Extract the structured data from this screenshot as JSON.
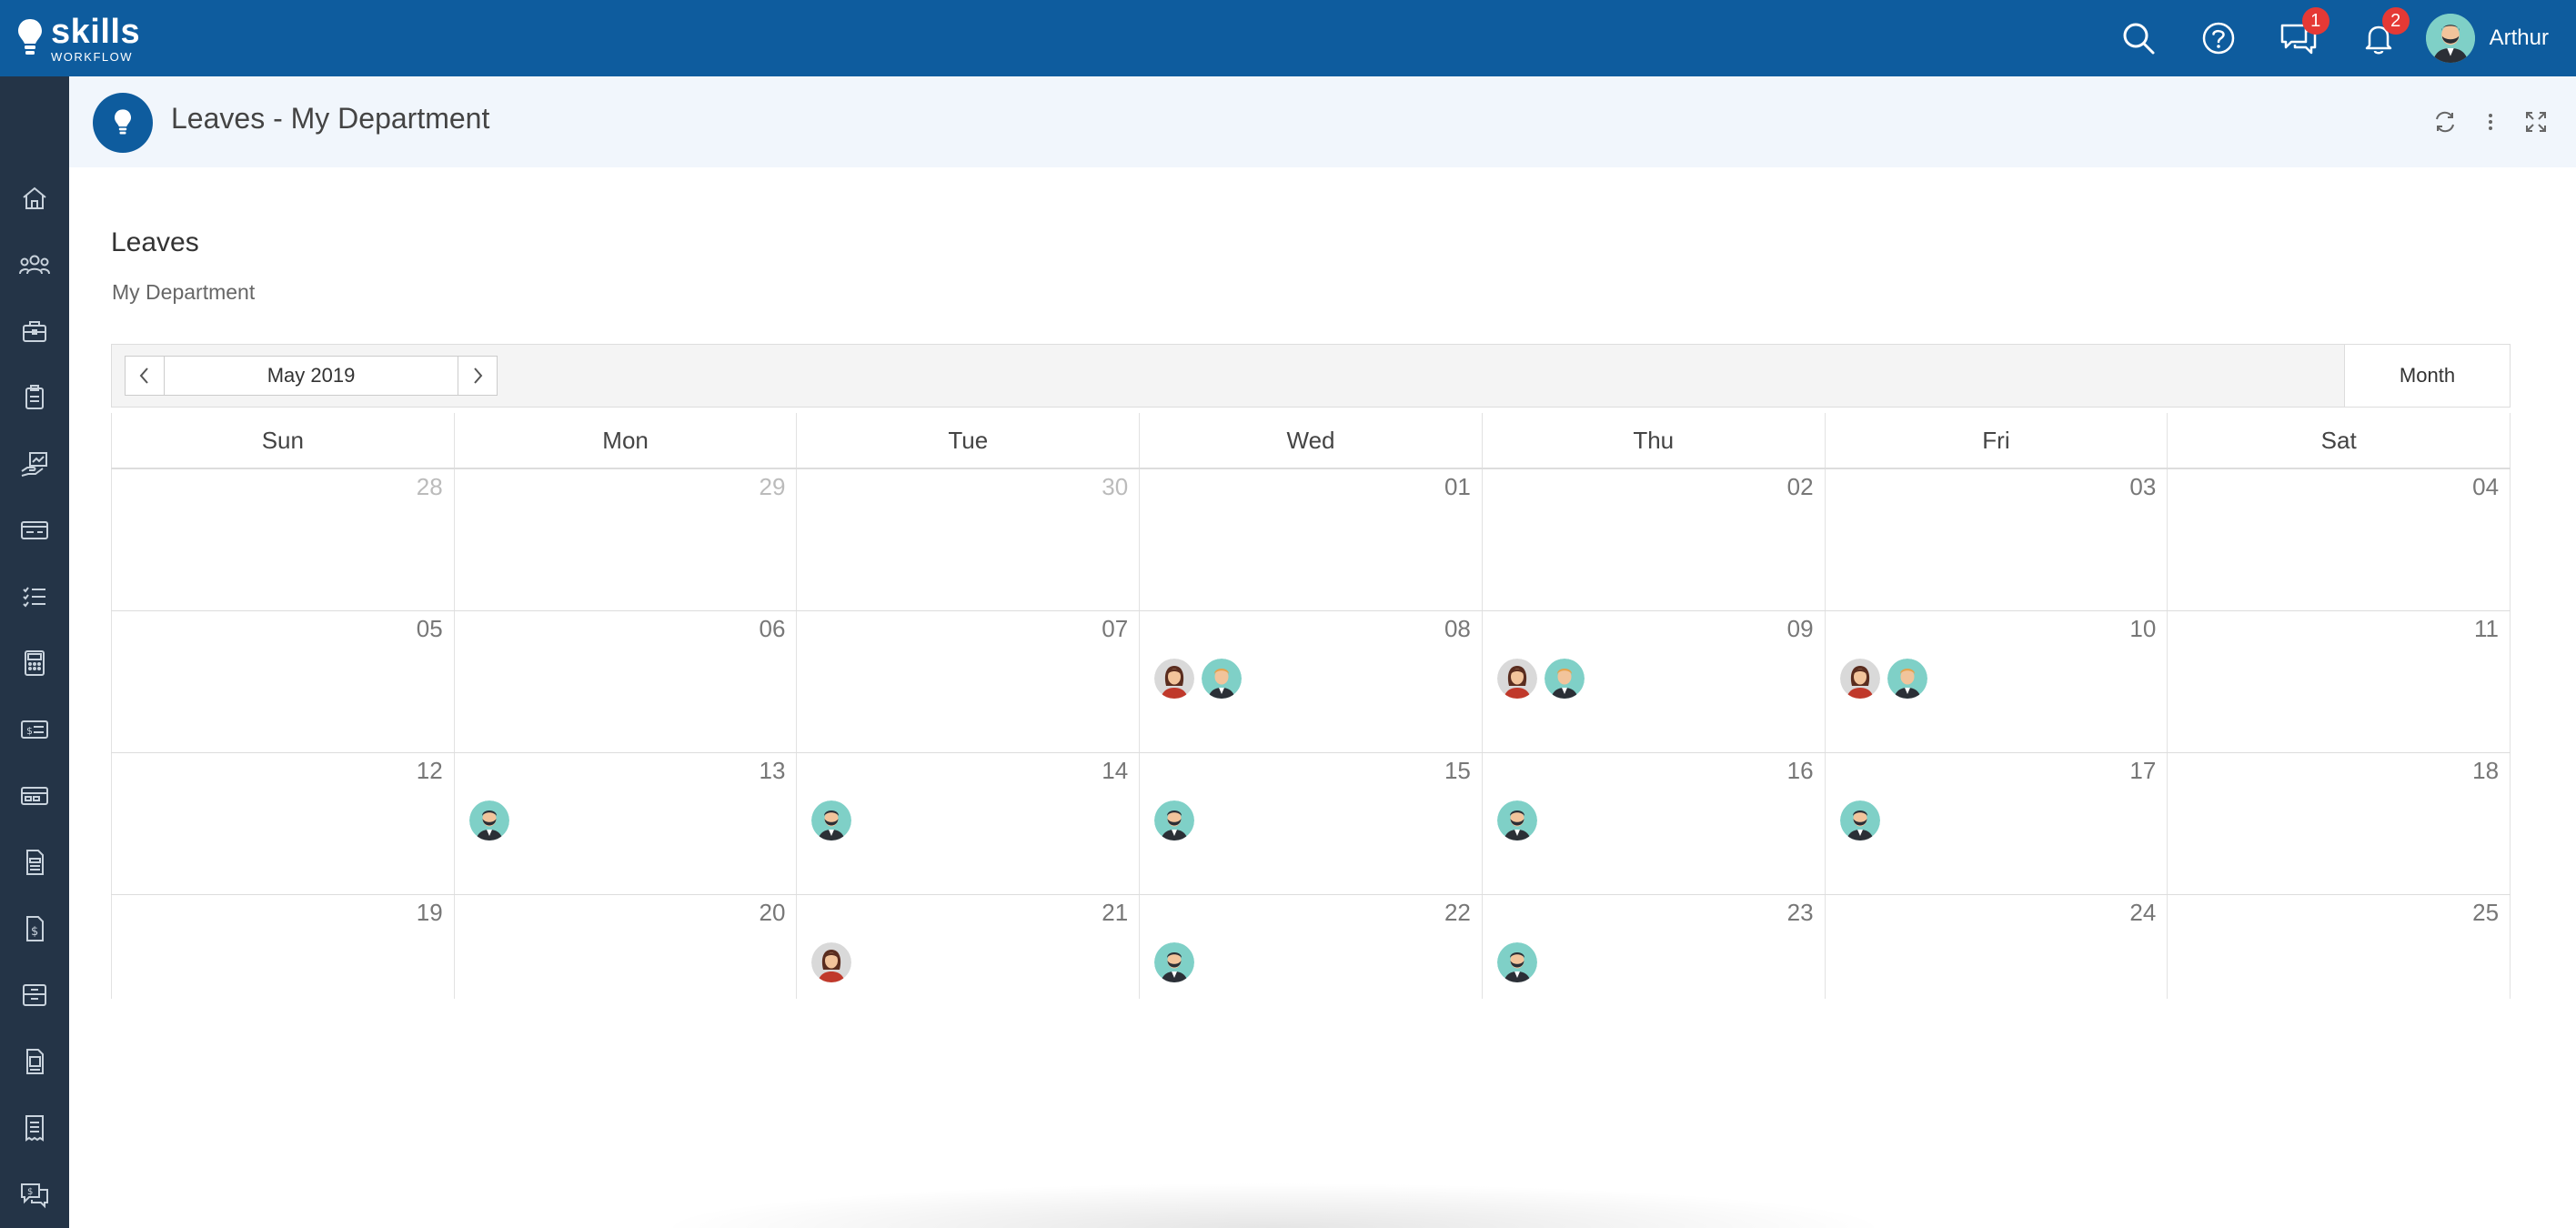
{
  "app": {
    "brand": "skills",
    "brand_sub": "WORKFLOW",
    "brand_color": "#0e5c9e",
    "sidebar_color": "#243447"
  },
  "topbar": {
    "icons": [
      "search-icon",
      "help-icon",
      "chat-icon",
      "bell-icon"
    ],
    "chat_badge": "1",
    "notification_badge": "2",
    "user_name": "Arthur"
  },
  "sidebar": {
    "items": [
      "home-icon",
      "people-icon",
      "briefcase-icon",
      "clipboard-icon",
      "chart-hand-icon",
      "card-icon",
      "checklist-icon",
      "calculator-icon",
      "dollar-card-icon",
      "payment-icon",
      "invoice-icon",
      "dollar-doc-icon",
      "archive-icon",
      "document-icon",
      "receipt-icon",
      "dollar-chat-icon"
    ]
  },
  "header": {
    "title": "Leaves - My Department",
    "actions": [
      "refresh-icon",
      "more-icon",
      "fullscreen-icon"
    ]
  },
  "section": {
    "title": "Leaves",
    "subtitle": "My Department"
  },
  "calendar": {
    "month_label": "May 2019",
    "view_label": "Month",
    "weekdays": [
      "Sun",
      "Mon",
      "Tue",
      "Wed",
      "Thu",
      "Fri",
      "Sat"
    ],
    "weeks": [
      [
        {
          "day": "28",
          "other": true,
          "people": []
        },
        {
          "day": "29",
          "other": true,
          "people": []
        },
        {
          "day": "30",
          "other": true,
          "people": []
        },
        {
          "day": "01",
          "other": false,
          "people": []
        },
        {
          "day": "02",
          "other": false,
          "people": []
        },
        {
          "day": "03",
          "other": false,
          "people": []
        },
        {
          "day": "04",
          "other": false,
          "people": []
        }
      ],
      [
        {
          "day": "05",
          "other": false,
          "people": []
        },
        {
          "day": "06",
          "other": false,
          "people": []
        },
        {
          "day": "07",
          "other": false,
          "people": []
        },
        {
          "day": "08",
          "other": false,
          "people": [
            "woman",
            "man-orange"
          ]
        },
        {
          "day": "09",
          "other": false,
          "people": [
            "woman",
            "man-orange"
          ]
        },
        {
          "day": "10",
          "other": false,
          "people": [
            "woman",
            "man-orange"
          ]
        },
        {
          "day": "11",
          "other": false,
          "people": []
        }
      ],
      [
        {
          "day": "12",
          "other": false,
          "people": []
        },
        {
          "day": "13",
          "other": false,
          "people": [
            "man-beard"
          ]
        },
        {
          "day": "14",
          "other": false,
          "people": [
            "man-beard"
          ]
        },
        {
          "day": "15",
          "other": false,
          "people": [
            "man-beard"
          ]
        },
        {
          "day": "16",
          "other": false,
          "people": [
            "man-beard"
          ]
        },
        {
          "day": "17",
          "other": false,
          "people": [
            "man-beard"
          ]
        },
        {
          "day": "18",
          "other": false,
          "people": []
        }
      ],
      [
        {
          "day": "19",
          "other": false,
          "people": []
        },
        {
          "day": "20",
          "other": false,
          "people": []
        },
        {
          "day": "21",
          "other": false,
          "people": [
            "woman"
          ]
        },
        {
          "day": "22",
          "other": false,
          "people": [
            "man-beard"
          ]
        },
        {
          "day": "23",
          "other": false,
          "people": [
            "man-beard"
          ]
        },
        {
          "day": "24",
          "other": false,
          "people": []
        },
        {
          "day": "25",
          "other": false,
          "people": []
        }
      ]
    ]
  }
}
